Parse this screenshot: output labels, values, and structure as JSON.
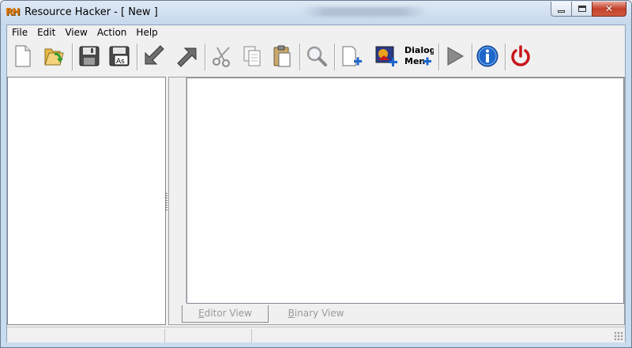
{
  "window": {
    "title": "Resource Hacker - [ New ]",
    "icon_text": "RH"
  },
  "menu": [
    "File",
    "Edit",
    "View",
    "Action",
    "Help"
  ],
  "toolbar": {
    "buttons": [
      {
        "name": "new",
        "icon": "new-file-icon"
      },
      {
        "name": "open",
        "icon": "open-folder-icon"
      },
      {
        "name": "save",
        "icon": "floppy-disk-icon"
      },
      {
        "name": "save-as",
        "icon": "save-as-icon",
        "label": "As"
      },
      {
        "name": "compile",
        "icon": "arrow-down-left-icon"
      },
      {
        "name": "action",
        "icon": "arrow-up-right-icon"
      },
      {
        "name": "cut",
        "icon": "scissors-icon"
      },
      {
        "name": "copy",
        "icon": "copy-icon"
      },
      {
        "name": "paste",
        "icon": "paste-icon"
      },
      {
        "name": "find",
        "icon": "magnifier-icon"
      },
      {
        "name": "add-blank",
        "icon": "add-blank-resource-icon"
      },
      {
        "name": "add-image",
        "icon": "add-image-resource-icon"
      },
      {
        "name": "dialog-menu",
        "icon": "dialog-menu-icon",
        "label_top": "Dialog",
        "label_bottom": "Men"
      },
      {
        "name": "run",
        "icon": "play-icon"
      },
      {
        "name": "about",
        "icon": "info-icon"
      },
      {
        "name": "exit",
        "icon": "power-icon"
      }
    ]
  },
  "tabs": {
    "editor": "Editor View",
    "editor_prefix": "",
    "editor_accel": "E",
    "editor_rest": "ditor View",
    "binary_prefix": "B",
    "binary_rest": "inary View"
  },
  "colors": {
    "accent_blue": "#1f67c9",
    "power_red": "#c8151b",
    "close_red": "#c5412b"
  }
}
